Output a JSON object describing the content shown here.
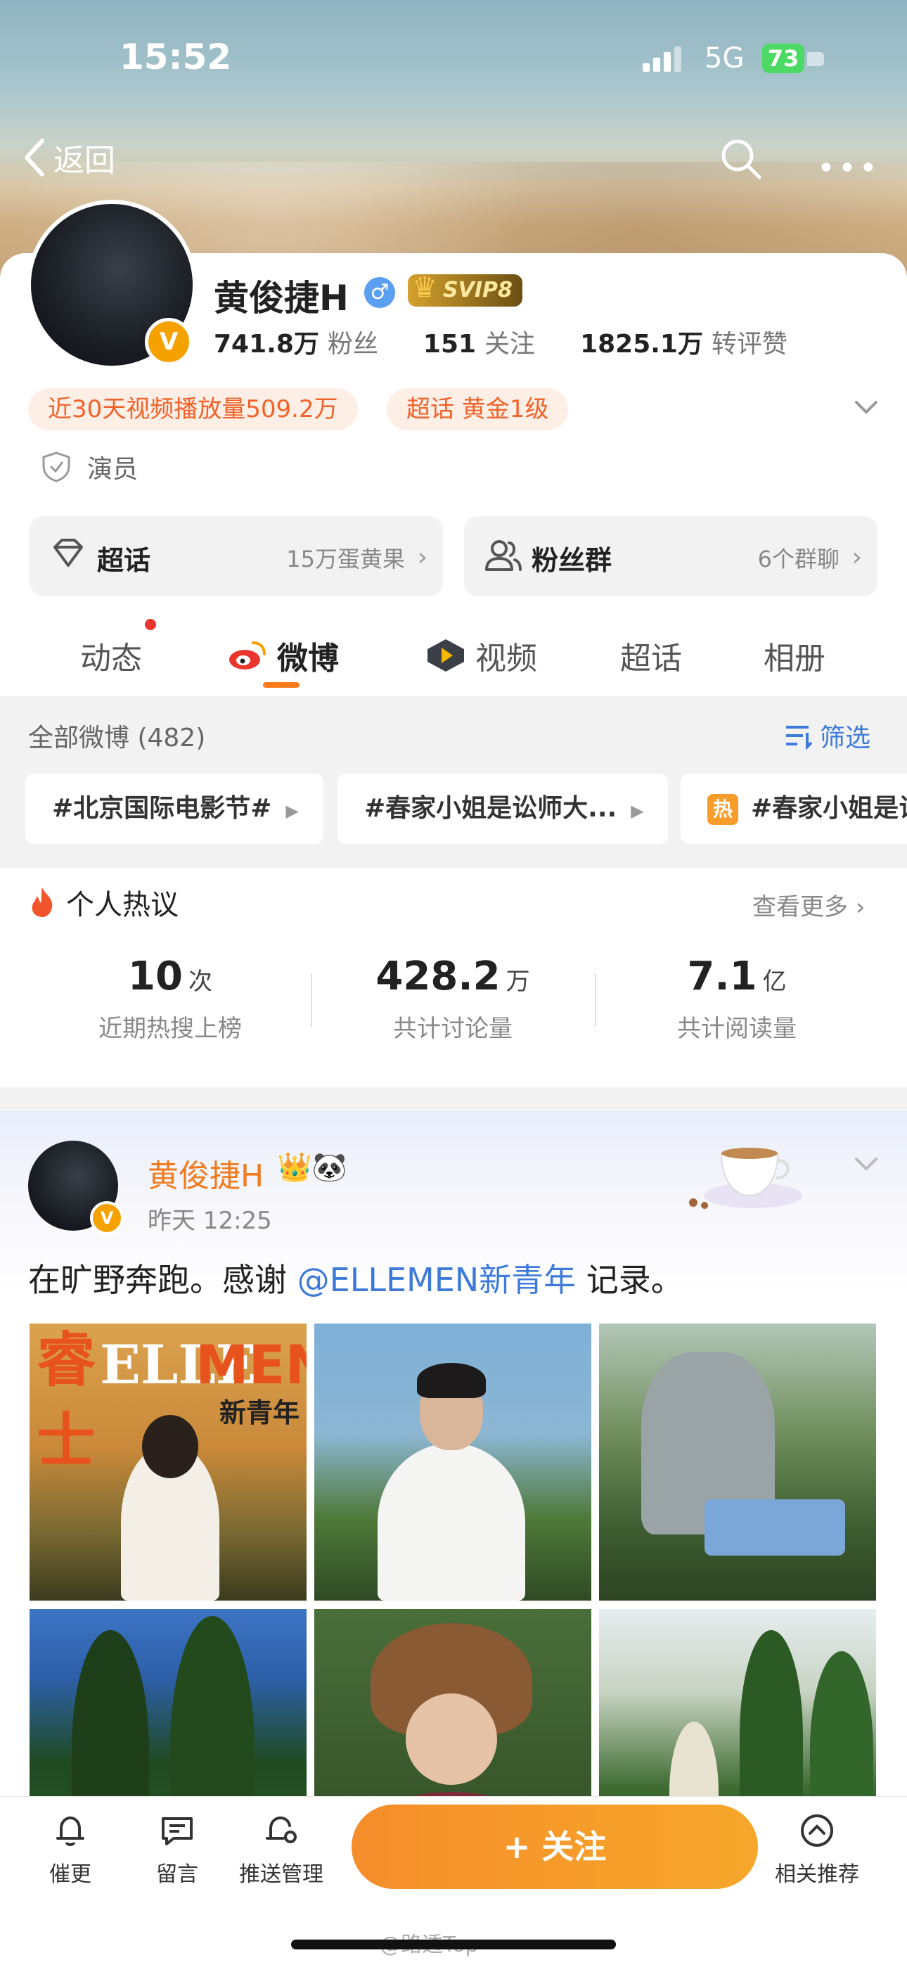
{
  "status": {
    "time": "15:52",
    "network": "5G",
    "battery": "73"
  },
  "nav": {
    "back_label": "返回"
  },
  "profile": {
    "name": "黄俊捷H",
    "gender_symbol": "♂",
    "vip": "SVIP8",
    "verify_badge": "V",
    "stats": [
      {
        "value": "741.8万",
        "label": "粉丝"
      },
      {
        "value": "151",
        "label": "关注"
      },
      {
        "value": "1825.1万",
        "label": "转评赞"
      }
    ],
    "pills": [
      "近30天视频播放量509.2万",
      "超话 黄金1级"
    ],
    "role": "演员"
  },
  "buttons": {
    "supertopic": {
      "label": "超话",
      "sub": "15万蛋黄果"
    },
    "fangroup": {
      "label": "粉丝群",
      "sub": "6个群聊"
    }
  },
  "tabs": [
    "动态",
    "微博",
    "视频",
    "超话",
    "相册"
  ],
  "filter": {
    "header": "全部微博 (482)",
    "button": "筛选",
    "hashtags": [
      "#北京国际电影节#",
      "#春家小姐是讼师大...",
      "#春家小姐是讼"
    ],
    "hot_mini": "热"
  },
  "hot_section": {
    "title": "个人热议",
    "more": "查看更多",
    "metrics": [
      {
        "value": "10",
        "unit": "次",
        "label": "近期热搜上榜"
      },
      {
        "value": "428.2",
        "unit": "万",
        "label": "共计讨论量"
      },
      {
        "value": "7.1",
        "unit": "亿",
        "label": "共计阅读量"
      }
    ]
  },
  "post": {
    "author": "黄俊捷H",
    "emoji": "👑🐼",
    "time": "昨天 12:25",
    "text_before": "在旷野奔跑。感谢 ",
    "mention": "@ELLEMEN新青年",
    "text_after": " 记录。",
    "cover": {
      "c1": "睿",
      "c2": "士",
      "elle": "ELLE",
      "men": "MEN",
      "sub": "新青年"
    }
  },
  "bottom_bar": {
    "items": [
      "催更",
      "留言",
      "推送管理",
      "相关推荐"
    ],
    "follow": "+ 关注"
  },
  "watermark": "@路透Top",
  "colors": {
    "accent": "#f58d2a",
    "link": "#3e7ad8",
    "orange_text": "#f0632a"
  }
}
